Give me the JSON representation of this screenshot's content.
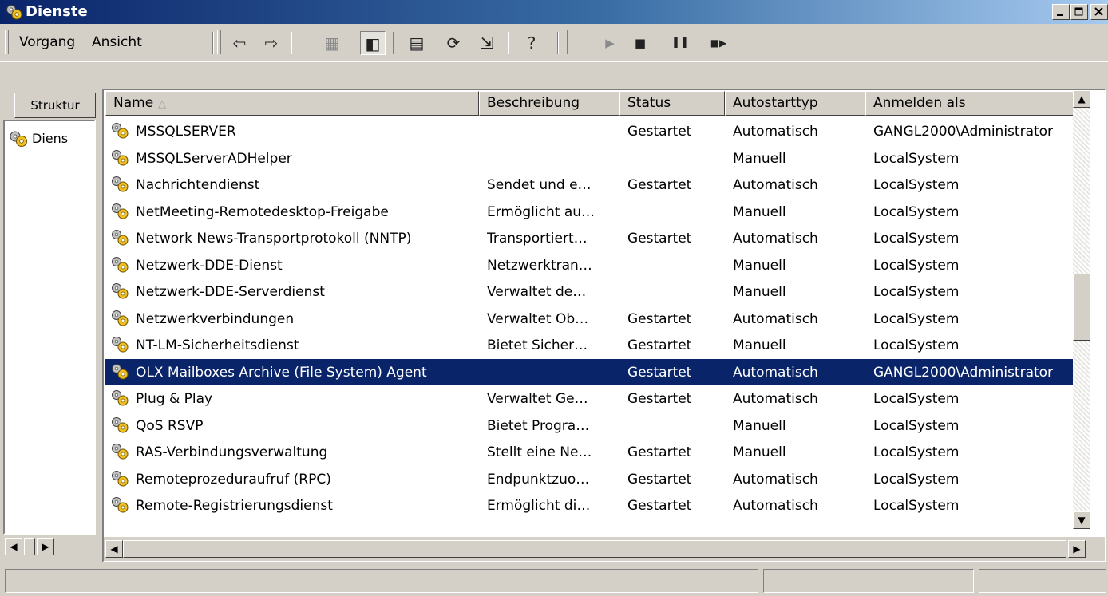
{
  "window": {
    "title": "Dienste",
    "controls": {
      "minimize": "_",
      "maximize": "□",
      "close": "×"
    }
  },
  "toolbar": {
    "menus": [
      {
        "label": "Vorgang"
      },
      {
        "label": "Ansicht"
      }
    ],
    "buttons": [
      {
        "name": "back",
        "glyph": "⇦"
      },
      {
        "name": "forward",
        "glyph": "⇨"
      },
      {
        "name": "up",
        "glyph": "▦"
      },
      {
        "name": "show-tree",
        "glyph": "◧"
      },
      {
        "name": "properties",
        "glyph": "▤"
      },
      {
        "name": "refresh",
        "glyph": "⟳"
      },
      {
        "name": "export-list",
        "glyph": "⇲"
      },
      {
        "name": "help",
        "glyph": "?"
      },
      {
        "name": "start",
        "glyph": "▶"
      },
      {
        "name": "stop",
        "glyph": "■"
      },
      {
        "name": "pause",
        "glyph": "❚❚"
      },
      {
        "name": "restart",
        "glyph": "■▶"
      }
    ]
  },
  "tree": {
    "tab_label": "Struktur",
    "item_label": "Diens"
  },
  "list": {
    "columns": [
      {
        "label": "Name",
        "sort": "ascending"
      },
      {
        "label": "Beschreibung"
      },
      {
        "label": "Status"
      },
      {
        "label": "Autostarttyp"
      },
      {
        "label": "Anmelden als"
      }
    ],
    "rows": [
      {
        "name": "MSSQLSERVER",
        "description": "",
        "status": "Gestartet",
        "startup": "Automatisch",
        "logon": "GANGL2000\\Administrator"
      },
      {
        "name": "MSSQLServerADHelper",
        "description": "",
        "status": "",
        "startup": "Manuell",
        "logon": "LocalSystem"
      },
      {
        "name": "Nachrichtendienst",
        "description": "Sendet und e…",
        "status": "Gestartet",
        "startup": "Automatisch",
        "logon": "LocalSystem"
      },
      {
        "name": "NetMeeting-Remotedesktop-Freigabe",
        "description": "Ermöglicht au…",
        "status": "",
        "startup": "Manuell",
        "logon": "LocalSystem"
      },
      {
        "name": "Network News-Transportprotokoll (NNTP)",
        "description": "Transportiert…",
        "status": "Gestartet",
        "startup": "Automatisch",
        "logon": "LocalSystem"
      },
      {
        "name": "Netzwerk-DDE-Dienst",
        "description": "Netzwerktran…",
        "status": "",
        "startup": "Manuell",
        "logon": "LocalSystem"
      },
      {
        "name": "Netzwerk-DDE-Serverdienst",
        "description": "Verwaltet de…",
        "status": "",
        "startup": "Manuell",
        "logon": "LocalSystem"
      },
      {
        "name": "Netzwerkverbindungen",
        "description": "Verwaltet Ob…",
        "status": "Gestartet",
        "startup": "Automatisch",
        "logon": "LocalSystem"
      },
      {
        "name": "NT-LM-Sicherheitsdienst",
        "description": "Bietet Sicher…",
        "status": "Gestartet",
        "startup": "Manuell",
        "logon": "LocalSystem"
      },
      {
        "name": "OLX Mailboxes Archive (File System) Agent",
        "description": "",
        "status": "Gestartet",
        "startup": "Automatisch",
        "logon": "GANGL2000\\Administrator",
        "selected": true
      },
      {
        "name": "Plug & Play",
        "description": "Verwaltet Ge…",
        "status": "Gestartet",
        "startup": "Automatisch",
        "logon": "LocalSystem"
      },
      {
        "name": "QoS RSVP",
        "description": "Bietet Progra…",
        "status": "",
        "startup": "Manuell",
        "logon": "LocalSystem"
      },
      {
        "name": "RAS-Verbindungsverwaltung",
        "description": "Stellt eine Ne…",
        "status": "Gestartet",
        "startup": "Manuell",
        "logon": "LocalSystem"
      },
      {
        "name": "Remoteprozeduraufruf (RPC)",
        "description": "Endpunktzuo…",
        "status": "Gestartet",
        "startup": "Automatisch",
        "logon": "LocalSystem"
      },
      {
        "name": "Remote-Registrierungsdienst",
        "description": "Ermöglicht di…",
        "status": "Gestartet",
        "startup": "Automatisch",
        "logon": "LocalSystem"
      }
    ]
  },
  "colors": {
    "selection": "#0a246a",
    "titlebar_start": "#0a246a",
    "titlebar_end": "#a6caf0",
    "face": "#d4d0c8"
  }
}
